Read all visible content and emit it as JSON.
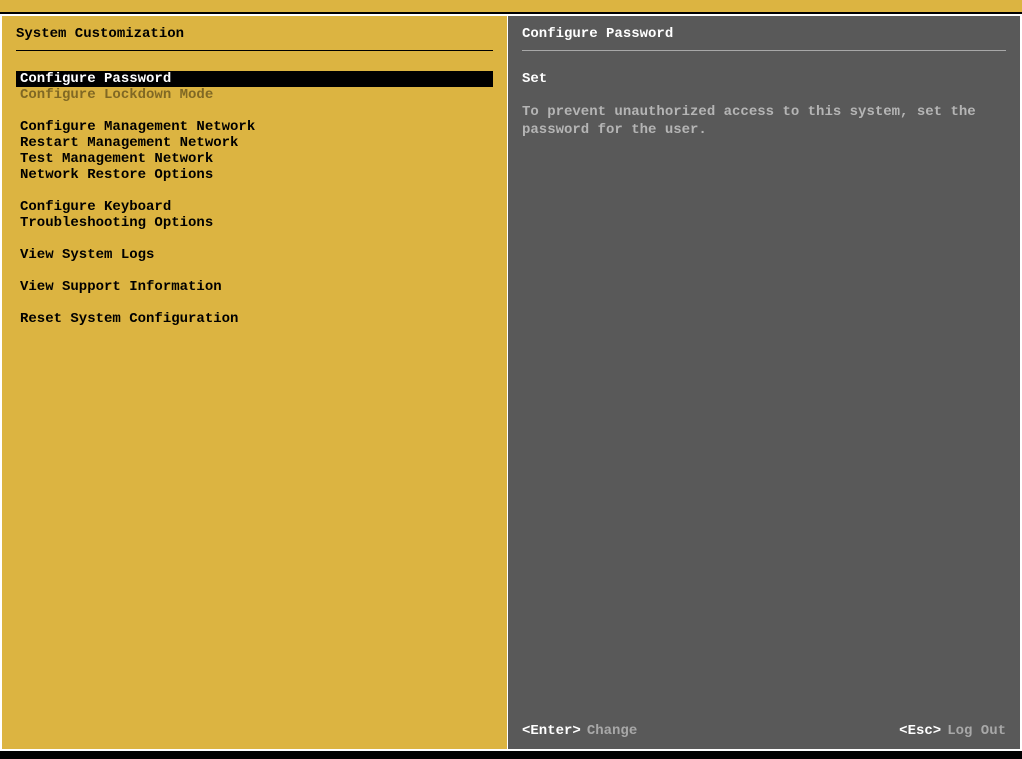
{
  "left": {
    "title": "System Customization",
    "groups": [
      [
        {
          "label": "Configure Password",
          "state": "selected"
        },
        {
          "label": "Configure Lockdown Mode",
          "state": "disabled"
        }
      ],
      [
        {
          "label": "Configure Management Network",
          "state": "normal"
        },
        {
          "label": "Restart Management Network",
          "state": "normal"
        },
        {
          "label": "Test Management Network",
          "state": "normal"
        },
        {
          "label": "Network Restore Options",
          "state": "normal"
        }
      ],
      [
        {
          "label": "Configure Keyboard",
          "state": "normal"
        },
        {
          "label": "Troubleshooting Options",
          "state": "normal"
        }
      ],
      [
        {
          "label": "View System Logs",
          "state": "normal"
        }
      ],
      [
        {
          "label": "View Support Information",
          "state": "normal"
        }
      ],
      [
        {
          "label": "Reset System Configuration",
          "state": "normal"
        }
      ]
    ]
  },
  "right": {
    "title": "Configure Password",
    "heading": "Set",
    "description": "To prevent unauthorized access to this system, set the password for the user."
  },
  "footer": {
    "enter_key": "<Enter>",
    "enter_action": "Change",
    "esc_key": "<Esc>",
    "esc_action": "Log Out"
  }
}
